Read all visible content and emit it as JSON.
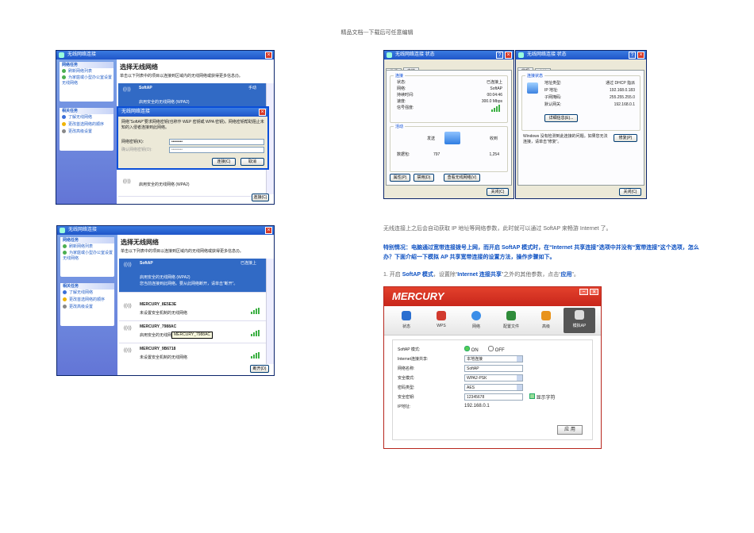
{
  "header": {
    "text": "精品文档---下载后可任意编辑"
  },
  "win1": {
    "title": "无线网络连接",
    "sidebar": {
      "tasks_title": "网络任务",
      "tasks": [
        "刷新网络列表",
        "为家庭或小型办公室设置无线网络"
      ],
      "related_title": "相关任务",
      "related": [
        "了解无线网络",
        "更改首选网络的顺序",
        "更改高级设置"
      ]
    },
    "heading": "选择无线网络",
    "instruction": "单击以下列表中的项目以连接到区域内的无线网络或获得更多信息(I)。",
    "network_name": "SoftAP",
    "network_status": "手动",
    "network_desc": "启用安全的无线网络 (WPA2)",
    "dialog": {
      "title": "无线网络连接",
      "msg": "网络“SoftAP”要求网络密钥(也称作 WEP 密钥或 WPA 密钥)。网络密钥帮助阻止未知的入侵者连接到此网络。",
      "key_label": "网络密钥(K):",
      "key_value": "••••••••",
      "confirm_label": "确认网络密钥(O):",
      "confirm_value": "••••••••",
      "connect": "连接(C)",
      "cancel": "取消"
    },
    "bottom_desc": "启用安全的无线网络 (WPA2)",
    "connect_btn": "连接(C)"
  },
  "win2": {
    "title": "无线网络连接 状态",
    "tabs": [
      "常规",
      "支持"
    ],
    "conn_legend": "连接",
    "rows": [
      {
        "k": "状态:",
        "v": "已连接上"
      },
      {
        "k": "网络:",
        "v": "SoftAP"
      },
      {
        "k": "持续时间:",
        "v": "00:04:46"
      },
      {
        "k": "速度:",
        "v": "300.0 Mbps"
      },
      {
        "k": "信号强度:",
        "v": ""
      }
    ],
    "act_legend": "活动",
    "sent": "发送",
    "recv": "收到",
    "packets_label": "数据包:",
    "sent_val": "797",
    "recv_val": "1,254",
    "btn_prop": "属性(P)",
    "btn_disable": "禁用(D)",
    "btn_view": "查看无线网络(V)",
    "btn_close": "关闭(C)"
  },
  "win3": {
    "title": "无线网络连接 状态",
    "tabs": [
      "常规",
      "支持"
    ],
    "legend": "连接状态",
    "rows": [
      {
        "k": "地址类型:",
        "v": "通过 DHCP 指派"
      },
      {
        "k": "IP 地址:",
        "v": "192.168.0.183"
      },
      {
        "k": "子网掩码:",
        "v": "255.255.255.0"
      },
      {
        "k": "默认网关:",
        "v": "192.168.0.1"
      }
    ],
    "details_btn": "详细信息(E)...",
    "repair_text": "Windows 没有检测到此连接的问题。如果您无法连接，请单击“修复”。",
    "repair_btn": "修复(P)",
    "close_btn": "关闭(C)"
  },
  "win4": {
    "title": "无线网络连接",
    "sidebar": {
      "tasks_title": "网络任务",
      "tasks": [
        "刷新网络列表",
        "为家庭或小型办公室设置无线网络"
      ],
      "related_title": "相关任务",
      "related": [
        "了解无线网络",
        "更改首选网络的顺序",
        "更改高级设置"
      ]
    },
    "heading": "选择无线网络",
    "instruction": "单击以下列表中的项目以连接到区域内的无线网络或获得更多信息(I)。",
    "networks": [
      {
        "name": "SoftAP",
        "status": "已连接上",
        "desc": "启用安全的无线网络 (WPA2)",
        "desc2": "您当前连接到此网络。要从此网络断开，请单击“断开”。",
        "sel": true
      },
      {
        "name": "MERCURY_8E5E3E",
        "status": "",
        "desc": "未设置安全机制的无线网络",
        "desc2": "",
        "sel": false
      },
      {
        "name": "MERCURY_7988AC",
        "status": "",
        "desc": "启用安全的无线网络",
        "desc2": "",
        "sel": false
      },
      {
        "name": "MERCURY_9B6718",
        "status": "",
        "desc": "未设置安全机制的无线网络",
        "desc2": "",
        "sel": false
      }
    ],
    "tooltip": "MERCURY_7988AC",
    "disconnect_btn": "断开(D)"
  },
  "text": {
    "p1": "无线连接上之后会自动获取 IP 地址等网络参数，此时就可以通过 SoftAP 来畅游 Internet 了。",
    "p2": "特别情况：电脑通过宽带连接拨号上网，而开启 SoftAP 模式时，在“Internet 共享连接”选项中并没有“宽带连接”这个选项，怎么办？下面介绍一下模拟 AP 共享宽带连接的设置方法，操作步骤如下。",
    "p3_pre": "1. 开启 ",
    "p3_a": "SoftAP 模式",
    "p3_b": "，设置除“",
    "p3_c": "Internet 连接共享",
    "p3_d": "”之外的其他参数，点击“",
    "p3_e": "应用",
    "p3_f": "”。"
  },
  "mercury": {
    "brand": "MERCURY",
    "toolbar": [
      "状态",
      "WPS",
      "网络",
      "配置文件",
      "高级",
      "模拟AP"
    ],
    "fields": [
      {
        "k": "SoftAP 模式:",
        "v": ""
      },
      {
        "k": "Internet连接共享:",
        "v": "本地连接"
      },
      {
        "k": "网络名称:",
        "v": "SoftAP"
      },
      {
        "k": "安全模式:",
        "v": "WPA2-PSK"
      },
      {
        "k": "密码类型:",
        "v": "AES"
      },
      {
        "k": "安全密钥:",
        "v": "12345678"
      },
      {
        "k": "IP地址:",
        "v": "192.168.0.1"
      }
    ],
    "on": "ON",
    "off": "OFF",
    "show_char": "显示字符",
    "apply": "应 用",
    "colors": {
      "brand_red": "#c8261b"
    }
  }
}
